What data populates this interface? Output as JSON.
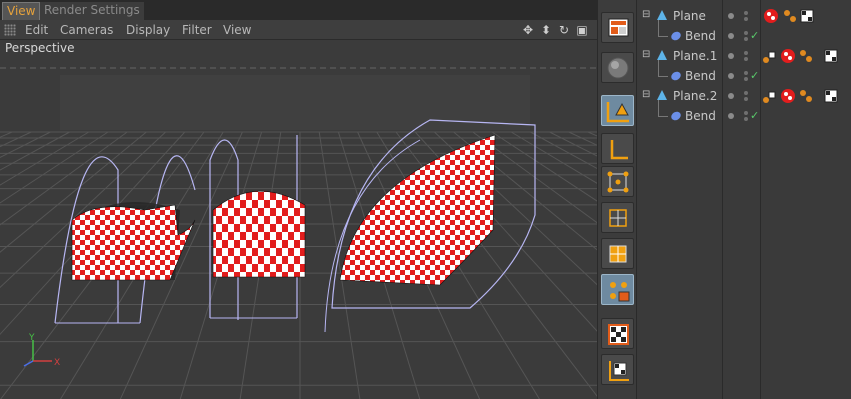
{
  "tabs": [
    {
      "label": "View",
      "active": true
    },
    {
      "label": "Render Settings",
      "active": false
    }
  ],
  "menu": [
    "Edit",
    "Cameras",
    "Display",
    "Filter",
    "View"
  ],
  "nav_icons": [
    "move-view-icon",
    "dolly-icon",
    "rotate-view-icon",
    "maximize-view-icon"
  ],
  "viewport": {
    "label": "Perspective",
    "axis_labels": {
      "y": "Y",
      "x": "X"
    },
    "colors": {
      "background": "#3b3b3b",
      "grid": "#555555",
      "checker_red": "#e21d1d",
      "checker_white": "#ffffff",
      "bbox": "#b7b6f3"
    }
  },
  "toolbar": [
    {
      "icon": "layout-icon",
      "active": false
    },
    {
      "icon": "render-sphere-icon",
      "active": false
    },
    {
      "icon": "model-mode-icon",
      "active": true
    },
    {
      "icon": "axis-mode-icon",
      "active": false
    },
    {
      "icon": "points-mode-icon",
      "active": false
    },
    {
      "icon": "edges-mode-icon",
      "active": false
    },
    {
      "icon": "polygons-mode-icon",
      "active": false
    },
    {
      "icon": "object-mode-icon",
      "active": true
    },
    {
      "icon": "texture-mode-icon",
      "active": false
    },
    {
      "icon": "workplane-icon",
      "active": false
    }
  ],
  "objects": [
    {
      "name": "Plane",
      "child": "Bend"
    },
    {
      "name": "Plane.1",
      "child": "Bend"
    },
    {
      "name": "Plane.2",
      "child": "Bend"
    }
  ]
}
